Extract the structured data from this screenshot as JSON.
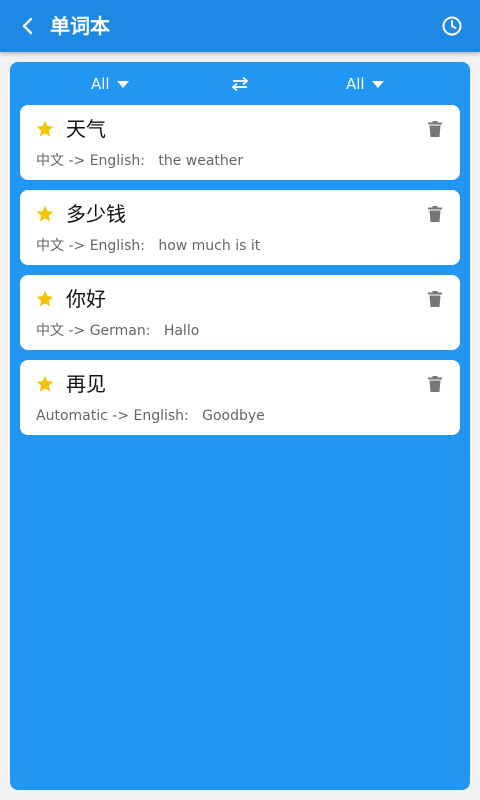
{
  "appbar": {
    "title": "单词本",
    "back_icon": "back-arrow-icon",
    "history_icon": "clock-icon"
  },
  "filters": {
    "source_language": "All",
    "target_language": "All",
    "swap_icon": "swap-arrows-icon"
  },
  "entries": [
    {
      "word": "天气",
      "source": "中文",
      "target": "English",
      "translation": "the weather",
      "starred": true
    },
    {
      "word": "多少钱",
      "source": "中文",
      "target": "English",
      "translation": "how much is it",
      "starred": true
    },
    {
      "word": "你好",
      "source": "中文",
      "target": "German",
      "translation": "Hallo",
      "starred": true
    },
    {
      "word": "再见",
      "source": "Automatic",
      "target": "English",
      "translation": "Goodbye",
      "starred": true
    }
  ],
  "colors": {
    "appbar": "#1e88e5",
    "panel": "#2196f3",
    "star": "#f5c400",
    "delete_icon": "#777777"
  }
}
